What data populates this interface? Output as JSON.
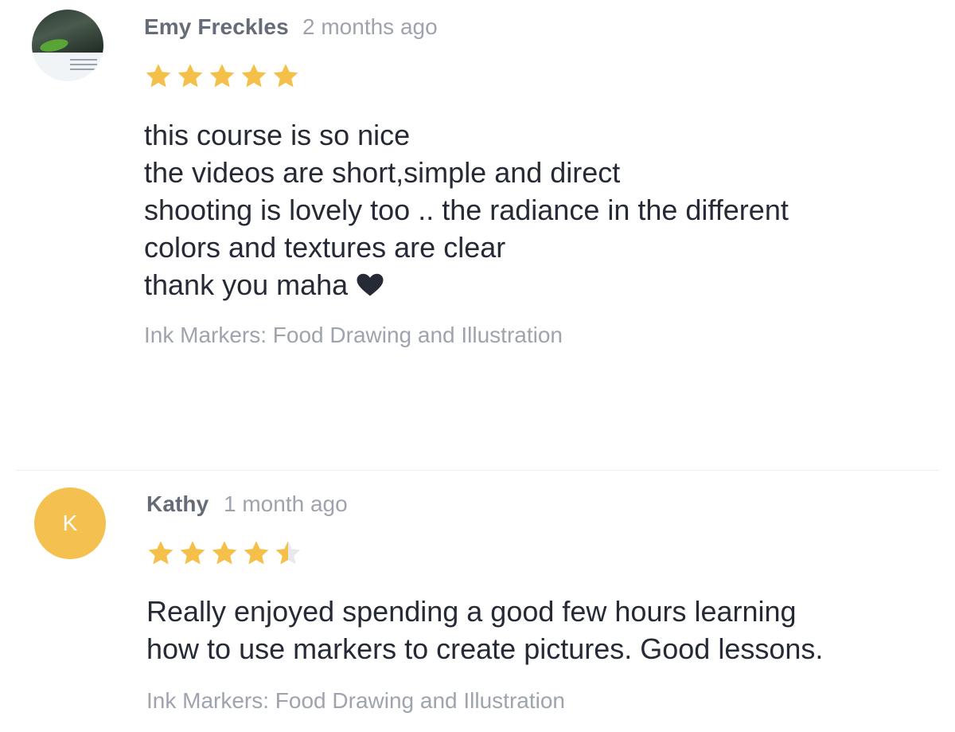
{
  "reviews": [
    {
      "author": "Emy Freckles",
      "time": "2 months ago",
      "avatar": {
        "type": "photo"
      },
      "rating": 5,
      "text_lines": [
        "this course is so nice",
        "the videos are short,simple and direct",
        "shooting is lovely too .. the radiance in the different",
        "colors and textures are clear",
        "thank you maha"
      ],
      "trailing_icon": "heart-icon",
      "course": "Ink Markers: Food Drawing and Illustration"
    },
    {
      "author": "Kathy",
      "time": "1 month ago",
      "avatar": {
        "type": "initial",
        "initial": "K",
        "color": "#f4c150"
      },
      "rating": 4.5,
      "text_lines": [
        "Really enjoyed spending a good few hours learning",
        "how to use markers to create pictures.  Good lessons."
      ],
      "course": "Ink Markers: Food Drawing and Illustration"
    }
  ],
  "colors": {
    "star_filled": "#f5c04a",
    "star_empty": "#e8e9ec",
    "author": "#666b78",
    "meta": "#9ea3ad",
    "body": "#262a36"
  }
}
